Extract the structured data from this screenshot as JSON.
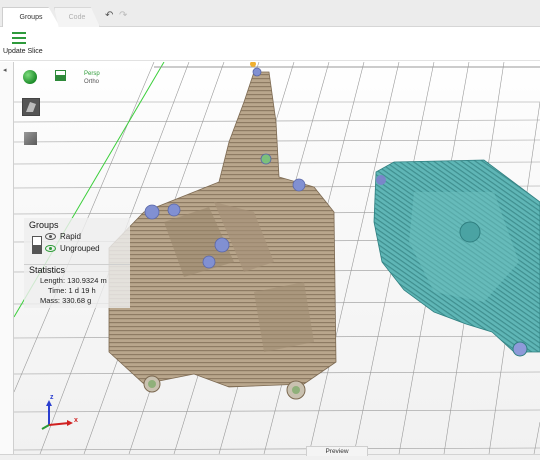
{
  "tabs": [
    {
      "label": "Groups",
      "active": true
    },
    {
      "label": "Code",
      "active": false
    }
  ],
  "toolbar": {
    "update_label": "Update Slice"
  },
  "view": {
    "mode_active": "Persp",
    "mode_inactive": "Ortho"
  },
  "groups": {
    "title": "Groups",
    "items": [
      {
        "label": "Rapid",
        "visible": true
      },
      {
        "label": "Ungrouped",
        "visible": true
      }
    ]
  },
  "statistics": {
    "title": "Statistics",
    "length": "Length: 130.9324 m",
    "time": "Time: 1 d 19 h",
    "mass": "Mass: 330.68 g"
  },
  "axes": {
    "z": "z",
    "x": "x"
  },
  "preview_label": "Preview",
  "colors": {
    "accent": "#2e9a3c",
    "part_tan": "#b5a38a",
    "part_teal": "#5cb3b4",
    "support_blue": "#7a86c9"
  }
}
